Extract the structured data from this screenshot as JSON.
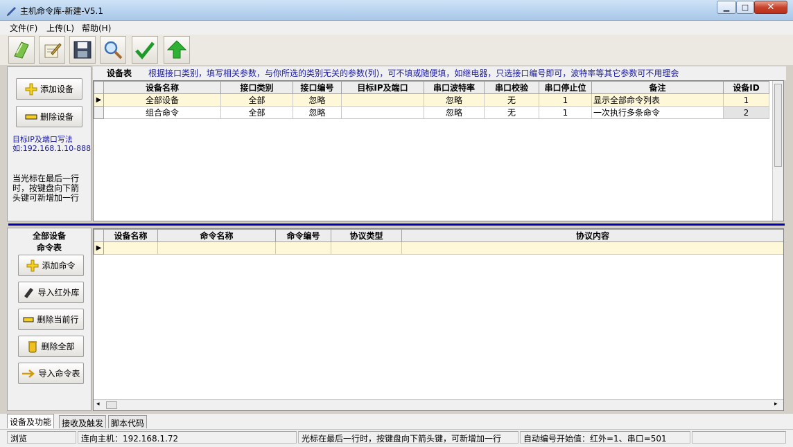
{
  "window": {
    "title": "主机命令库-新建-V5.1",
    "min_symbol": "▁",
    "max_symbol": "□",
    "close_symbol": "✕"
  },
  "menu": [
    "文件(F)",
    "上传(L)",
    "帮助(H)"
  ],
  "toolbar_icons": [
    "open-book-icon",
    "edit-notepad-icon",
    "save-disk-icon",
    "search-magnifier-icon",
    "check-confirm-icon",
    "upload-arrow-icon"
  ],
  "left_top": {
    "add_device": "添加设备",
    "delete_device": "删除设备",
    "ip_hint_1": "目标IP及端口写法",
    "ip_hint_2": "如:192.168.1.10-888",
    "cursor_hint": "当光标在最后一行时，按键盘向下箭头键可新增加一行"
  },
  "device_table": {
    "label": "设备表",
    "hint": "根据接口类别，填写相关参数，与你所选的类别无关的参数(列)，可不填或随便填，如继电器，只选接口编号即可，波特率等其它参数可不用理会",
    "columns": [
      "设备名称",
      "接口类别",
      "接口编号",
      "目标IP及端口",
      "串口波特率",
      "串口校验",
      "串口停止位",
      "备注",
      "设备ID"
    ],
    "rows": [
      [
        "全部设备",
        "全部",
        "忽略",
        "",
        "忽略",
        "无",
        "1",
        "显示全部命令列表",
        "1"
      ],
      [
        "组合命令",
        "全部",
        "忽略",
        "",
        "忽略",
        "无",
        "1",
        "一次执行多条命令",
        "2"
      ]
    ],
    "selected_marker": "▶"
  },
  "left_bottom": {
    "title_1": "全部设备",
    "title_2": "命令表",
    "add_command": "添加命令",
    "import_ir": "导入红外库",
    "delete_current": "删除当前行",
    "delete_all": "删除全部",
    "import_table": "导入命令表"
  },
  "command_table": {
    "columns": [
      "设备名称",
      "命令名称",
      "命令编号",
      "协议类型",
      "协议内容"
    ],
    "selected_marker": "▶"
  },
  "tabs": [
    "设备及功能",
    "接收及触发",
    "脚本代码"
  ],
  "status": {
    "mode": "浏览",
    "connection": "连向主机：192.168.1.72",
    "hint": "光标在最后一行时，按键盘向下箭头键，可新增加一行",
    "auto_number": "自动编号开始值：红外=1、串口=501"
  },
  "colors": {
    "divider": "#0000b0",
    "hint_text": "#1a1aa0",
    "selected_row": "#fff8d8"
  }
}
